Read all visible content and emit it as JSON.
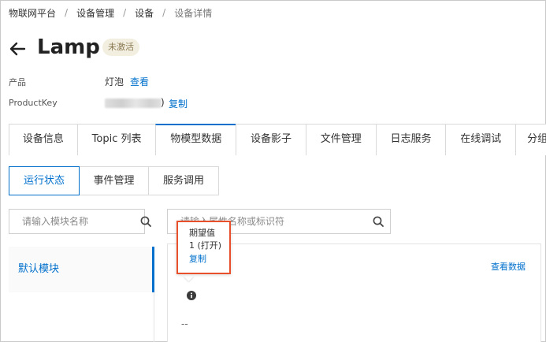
{
  "breadcrumb": [
    "物联网平台",
    "设备管理",
    "设备",
    "设备详情"
  ],
  "breadcrumb_separator": "/",
  "device": {
    "title": "Lamp",
    "status": "未激活"
  },
  "info": {
    "product_label": "产品",
    "product_value": "灯泡",
    "product_link": "查看",
    "productkey_label": "ProductKey",
    "productkey_suffix": ")",
    "copy_link": "复制"
  },
  "main_tabs": [
    "设备信息",
    "Topic 列表",
    "物模型数据",
    "设备影子",
    "文件管理",
    "日志服务",
    "在线调试",
    "分组"
  ],
  "main_tab_active": "物模型数据",
  "sub_tabs": [
    "运行状态",
    "事件管理",
    "服务调用"
  ],
  "sub_tab_active": "运行状态",
  "module_search": {
    "placeholder": "请输入模块名称"
  },
  "property_search": {
    "placeholder": "请输入属性名称或标识符"
  },
  "modules": [
    {
      "label": "默认模块"
    }
  ],
  "property_card": {
    "view_data_link": "查看数据",
    "value": "--"
  },
  "popover": {
    "title": "期望值",
    "value": "1 (打开)",
    "copy": "复制"
  },
  "colors": {
    "accent": "#0070cc",
    "highlight_border": "#e8502b",
    "badge_bg": "#f3efe0"
  }
}
